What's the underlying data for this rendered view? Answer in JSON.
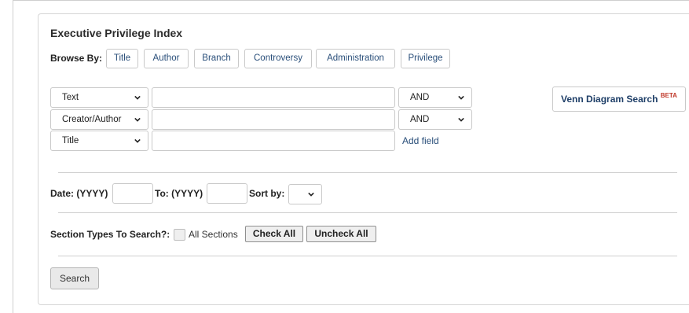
{
  "page": {
    "title": "Executive Privilege Index"
  },
  "browse": {
    "label": "Browse By:",
    "buttons": [
      "Title",
      "Author",
      "Branch",
      "Controversy",
      "Administration",
      "Privilege"
    ]
  },
  "search_rows": [
    {
      "field": "Text",
      "value": "",
      "operator": "AND"
    },
    {
      "field": "Creator/Author",
      "value": "",
      "operator": "AND"
    },
    {
      "field": "Title",
      "value": ""
    }
  ],
  "add_field_label": "Add field",
  "venn": {
    "label": "Venn Diagram Search",
    "badge": "BETA"
  },
  "date": {
    "from_label": "Date: (YYYY)",
    "to_label": "To: (YYYY)",
    "sort_label": "Sort by:",
    "from_value": "",
    "to_value": "",
    "sort_value": ""
  },
  "sections": {
    "label": "Section Types To Search?:",
    "checkbox_label": "All Sections",
    "check_all": "Check All",
    "uncheck_all": "Uncheck All"
  },
  "search_button": "Search",
  "icons": {
    "dropdown": "chevron-down-icon"
  }
}
